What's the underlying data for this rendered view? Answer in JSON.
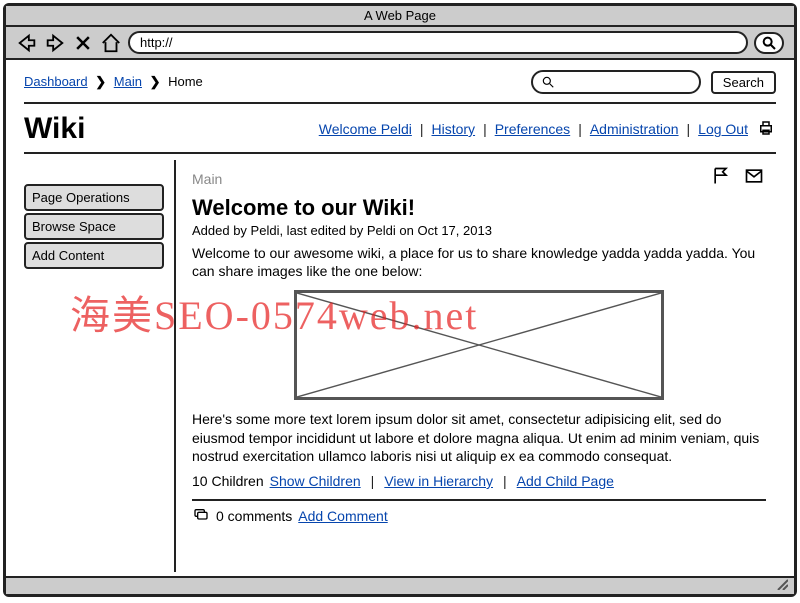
{
  "window": {
    "title": "A Web Page",
    "url": "http://"
  },
  "breadcrumbs": {
    "dashboard": "Dashboard",
    "main": "Main",
    "home": "Home"
  },
  "search": {
    "button": "Search"
  },
  "site": {
    "title": "Wiki"
  },
  "topnav": {
    "welcome": "Welcome Peldi",
    "history": "History",
    "preferences": "Preferences",
    "administration": "Administration",
    "logout": "Log Out"
  },
  "sidebar": {
    "page_ops": "Page Operations",
    "browse": "Browse Space",
    "add": "Add Content"
  },
  "page": {
    "space": "Main",
    "title": "Welcome to our Wiki!",
    "byline": "Added by Peldi, last edited by Peldi on Oct 17, 2013",
    "intro": "Welcome to our awesome wiki, a place for us to share knowledge yadda yadda yadda. You can share images like the one below:",
    "lorem": "Here's some more text lorem ipsum dolor sit amet, consectetur adipisicing elit, sed do eiusmod tempor incididunt ut labore et dolore magna aliqua. Ut enim ad minim veniam, quis nostrud exercitation ullamco laboris nisi ut aliquip ex ea commodo consequat.",
    "children_count": "10 Children",
    "show_children": "Show Children",
    "view_hierarchy": "View in Hierarchy",
    "add_child": "Add Child Page",
    "comments_count": "0 comments",
    "add_comment": "Add Comment"
  },
  "watermark": "海美SEO-0574web.net"
}
